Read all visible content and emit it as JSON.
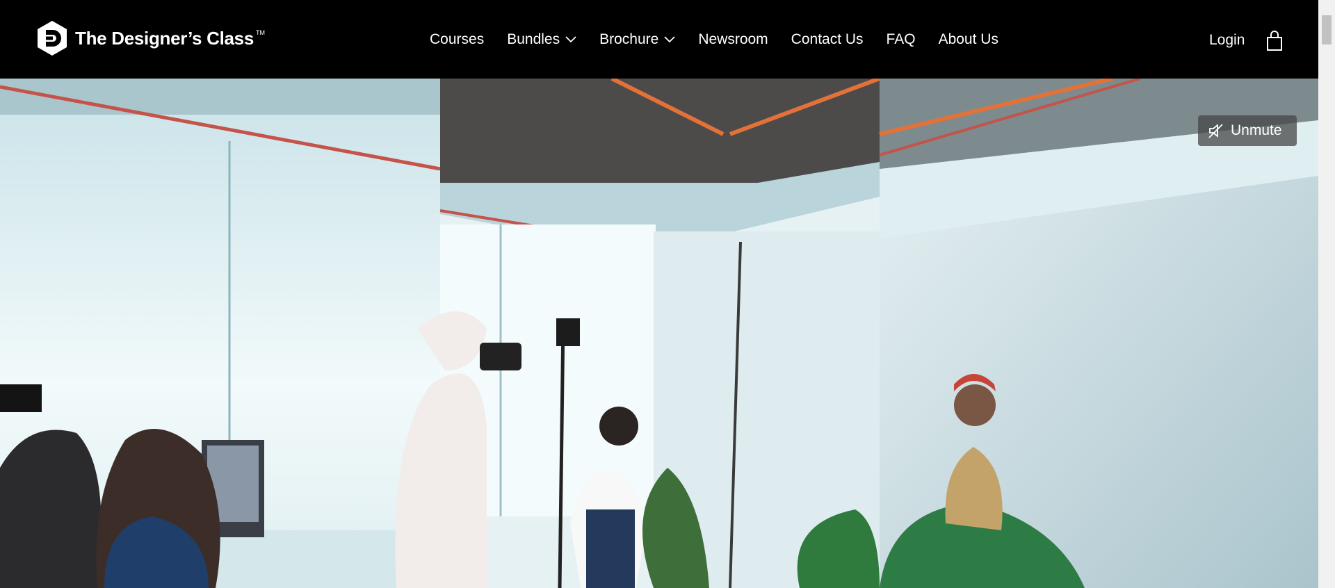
{
  "brand": {
    "name": "The Designer’s Class",
    "tm": "TM",
    "logo_icon": "hexagon-d-logo"
  },
  "nav": {
    "items": [
      {
        "label": "Courses"
      },
      {
        "label": "Bundles",
        "has_dropdown": true
      },
      {
        "label": "Brochure",
        "has_dropdown": true
      },
      {
        "label": "Newsroom"
      },
      {
        "label": "Contact Us"
      },
      {
        "label": "FAQ"
      },
      {
        "label": "About Us"
      }
    ]
  },
  "account": {
    "login_label": "Login",
    "cart_icon": "shopping-bag-icon"
  },
  "video": {
    "unmute_label": "Unmute",
    "muted_icon": "speaker-muted-icon",
    "content": "three-panel photo studio shoot"
  },
  "colors": {
    "header_bg": "#000000",
    "text": "#ffffff",
    "button_bg": "rgba(70,70,70,0.75)",
    "scroll_track": "#f1f1f1",
    "scroll_thumb": "#c1c1c1"
  }
}
